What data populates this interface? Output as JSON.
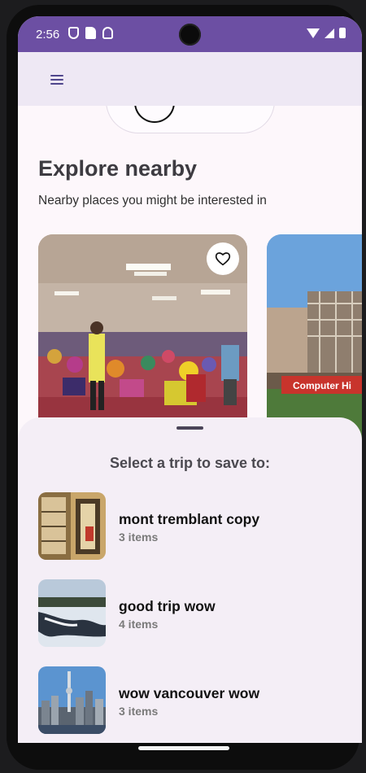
{
  "status_bar": {
    "time": "2:56",
    "left_icons": [
      "shield-icon",
      "sd-card-icon",
      "ghost-icon"
    ],
    "right_icons": [
      "wifi-icon",
      "signal-icon",
      "battery-icon"
    ]
  },
  "app_bar": {
    "menu_icon": "hamburger-menu-icon"
  },
  "explore": {
    "title": "Explore nearby",
    "subtitle": "Nearby places you might be interested in",
    "card_2_caption": "Computer Hi"
  },
  "sheet": {
    "title": "Select a trip to save to:",
    "trips": [
      {
        "name": "mont tremblant copy",
        "count": "3 items"
      },
      {
        "name": "good trip wow",
        "count": "4 items"
      },
      {
        "name": "wow vancouver wow",
        "count": "3 items"
      }
    ]
  },
  "colors": {
    "status_bar": "#6c4fa3",
    "app_bar": "#eee8f4",
    "sheet": "#f4eef6",
    "accent": "#4f468c"
  }
}
